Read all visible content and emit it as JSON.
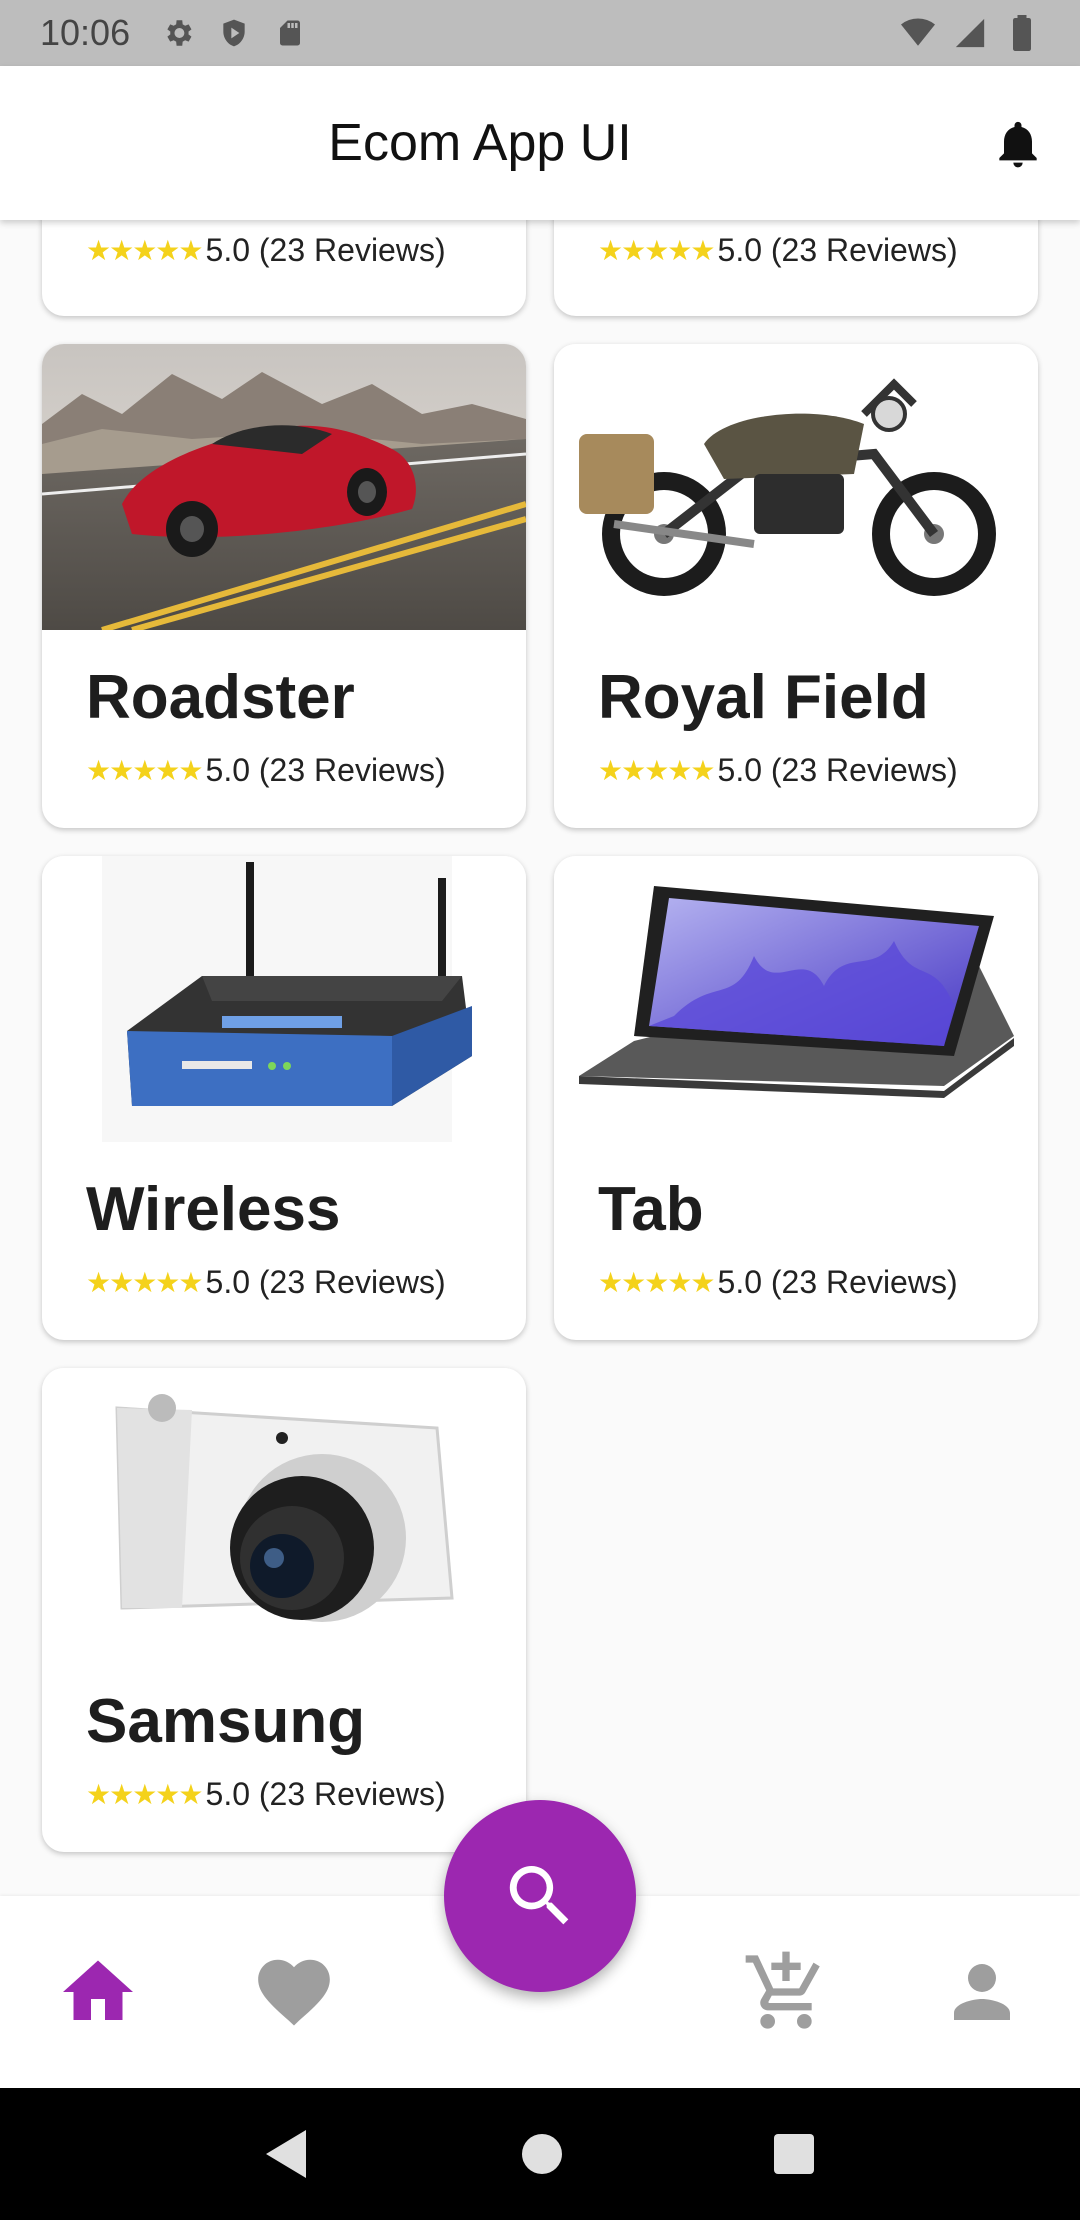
{
  "status_bar": {
    "time": "10:06"
  },
  "app_bar": {
    "title": "Ecom App UI"
  },
  "products": [
    {
      "name": "",
      "stars": "★★★★★",
      "rating_text": "5.0 (23 Reviews)"
    },
    {
      "name": "",
      "stars": "★★★★★",
      "rating_text": "5.0 (23 Reviews)"
    },
    {
      "name": "Roadster",
      "stars": "★★★★★",
      "rating_text": "5.0 (23 Reviews)",
      "image_icon": "red-sports-car"
    },
    {
      "name": "Royal Field",
      "stars": "★★★★★",
      "rating_text": "5.0 (23 Reviews)",
      "image_icon": "motorcycle"
    },
    {
      "name": "Wireless",
      "stars": "★★★★★",
      "rating_text": "5.0 (23 Reviews)",
      "image_icon": "wireless-router"
    },
    {
      "name": "Tab",
      "stars": "★★★★★",
      "rating_text": "5.0 (23 Reviews)",
      "image_icon": "tablet"
    },
    {
      "name": "Samsung",
      "stars": "★★★★★",
      "rating_text": "5.0 (23 Reviews)",
      "image_icon": "camera"
    }
  ],
  "bottom_nav": {
    "items": [
      "home-icon",
      "heart-icon",
      "cart-add-icon",
      "person-icon"
    ],
    "active": "home-icon",
    "fab_icon": "search-icon"
  },
  "colors": {
    "accent": "#9c27b0",
    "star": "#f4d21b",
    "inactive_icon": "#9e9e9e"
  }
}
